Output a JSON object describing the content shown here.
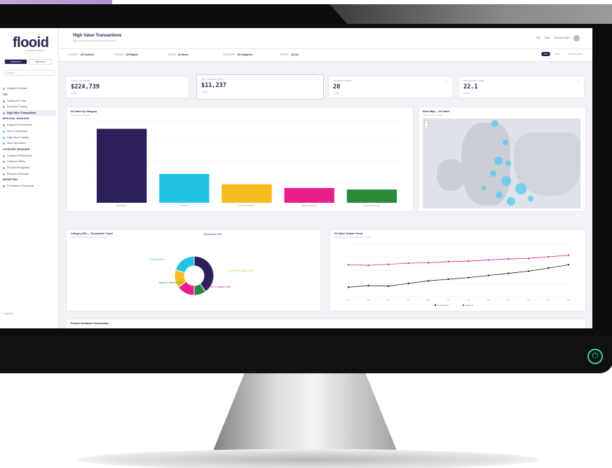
{
  "app": {
    "logo": "flooid",
    "logo_sub": "an INVENT company"
  },
  "sidebar": {
    "toggle": [
      "INSIGHTS",
      "REPORTS"
    ],
    "search_placeholder": "Search...",
    "items": [
      {
        "type": "item",
        "label": "Insights Overview",
        "active": false
      },
      {
        "type": "head",
        "label": "TSS"
      },
      {
        "type": "item",
        "label": "Trading KPI Tiles",
        "active": false
      },
      {
        "type": "item",
        "label": "Executive Trading",
        "active": false
      },
      {
        "type": "item",
        "label": "High Value Transactions",
        "active": true
      },
      {
        "type": "head",
        "label": "REGIONAL MANAGER"
      },
      {
        "type": "item",
        "label": "Regional Performance",
        "active": false
      },
      {
        "type": "item",
        "label": "Store Comparison",
        "active": false
      },
      {
        "type": "item",
        "label": "Daily Store Trading",
        "active": false
      },
      {
        "type": "item",
        "label": "Store Operations",
        "active": false
      },
      {
        "type": "head",
        "label": "CATEGORY MANAGER"
      },
      {
        "type": "item",
        "label": "Category Performance",
        "active": false
      },
      {
        "type": "item",
        "label": "Category Affinity",
        "active": false
      },
      {
        "type": "item",
        "label": "Product Recognition",
        "active": false
      },
      {
        "type": "item",
        "label": "Returns & Refunds",
        "active": false
      },
      {
        "type": "head",
        "label": "MARKETING"
      },
      {
        "type": "item",
        "label": "Promotions & Discounts",
        "active": false
      }
    ],
    "footer": "Log Out"
  },
  "header": {
    "title": "High Value Transactions",
    "subtitle": "High value transaction activity across all stores",
    "right": [
      "Edit",
      "Save",
      "Deanna Smith"
    ]
  },
  "filters": [
    {
      "label": "COUNTRY",
      "value": "All Countries"
    },
    {
      "label": "REGION",
      "value": "All Regions"
    },
    {
      "label": "STORE",
      "value": "All Stores"
    },
    {
      "label": "CATEGORY",
      "value": "All Categories"
    },
    {
      "label": "PERIOD",
      "value": "Q3 Jan"
    }
  ],
  "period_toggle": [
    "WK",
    "MTH",
    "YEAR TO DATE"
  ],
  "kpis": [
    {
      "label": "TOTAL HV SALES",
      "value": "$224,739",
      "delta": "+ 4.8%"
    },
    {
      "label": "AVG TRANSACTION",
      "value": "$11,237",
      "delta": "+ 1.6%"
    },
    {
      "label": "TRANSACTIONS",
      "value": "20",
      "delta": "+ 4.8%"
    },
    {
      "label": "AVG BASKET SIZE",
      "value": "22.1",
      "delta": "+ 2.2%"
    }
  ],
  "bar_card": {
    "title": "HV Sales by Category",
    "subtitle": "Total sales by category"
  },
  "map_card": {
    "title": "Store Map — HV Sales",
    "subtitle": "Sales by store location"
  },
  "donut_card": {
    "title": "Category Mix — Transaction Count",
    "subtitle": "Distribution of HV transactions by category"
  },
  "line_card": {
    "title": "HV Sales Volume Trend",
    "subtitle": "Weekly trend of transactions and revenue"
  },
  "bottom_card": {
    "title": "Product Drilldown Transactions"
  },
  "colors": {
    "navy": "#2e1e5b",
    "cyan": "#21c3e3",
    "amber": "#f6bb1f",
    "magenta": "#e91d8c",
    "green": "#2c8a39"
  },
  "chart_data": [
    {
      "type": "bar",
      "categories": [
        "Electronics",
        "Clothing",
        "Home & Kitchen",
        "Health & Beauty",
        "Food & Beverage"
      ],
      "values": [
        100,
        39,
        25,
        20,
        18
      ],
      "ylim": [
        0,
        110
      ]
    },
    {
      "type": "pie",
      "categories": [
        "Electronics 40%",
        "Clothing 20%",
        "Food & Beverage 15%",
        "Home & Garden 15%",
        "Health & Beauty 10%"
      ],
      "values": [
        40,
        20,
        15,
        15,
        10
      ]
    },
    {
      "type": "line",
      "x": [
        "Jan",
        "Feb",
        "Mar",
        "Apr",
        "May",
        "Jun",
        "Jul",
        "Aug",
        "Sep",
        "Oct",
        "Nov",
        "Dec"
      ],
      "series": [
        {
          "name": "Transactions",
          "values": [
            18,
            21,
            20,
            25,
            30,
            33,
            36,
            40,
            44,
            48,
            54,
            60
          ]
        },
        {
          "name": "Revenue",
          "values": [
            60,
            59,
            61,
            63,
            64,
            66,
            67,
            69,
            71,
            72,
            75,
            78
          ]
        }
      ],
      "ylim": [
        0,
        100
      ]
    }
  ]
}
